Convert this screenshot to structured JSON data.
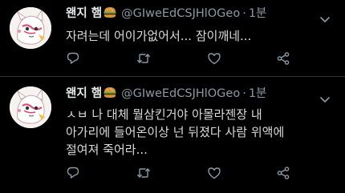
{
  "colors": {
    "background": "#000000",
    "text": "#d9d9d9",
    "secondary": "#8b98a5",
    "divider": "#2f3336"
  },
  "tweets": [
    {
      "display_name": "왠지 햄",
      "name_emoji": "hamburger-icon",
      "handle": "@GIweEdCSJHlOGeo",
      "separator": "·",
      "time": "1분",
      "text": "자려는데 어이가없어서... 잠이깨네...",
      "actions": [
        "reply-icon",
        "retweet-icon",
        "like-icon",
        "share-icon"
      ]
    },
    {
      "display_name": "왠지 햄",
      "name_emoji": "hamburger-icon",
      "handle": "@GIweEdCSJHlOGeo",
      "separator": "·",
      "time": "1분",
      "text": "ㅅㅂ 나 대체 뭘삼킨거야 아몰라젠장 내\n아가리에 들어온이상 넌 뒤졌다 사람 위액에\n절여져 죽어라...",
      "actions": [
        "reply-icon",
        "retweet-icon",
        "like-icon",
        "share-icon"
      ]
    }
  ]
}
